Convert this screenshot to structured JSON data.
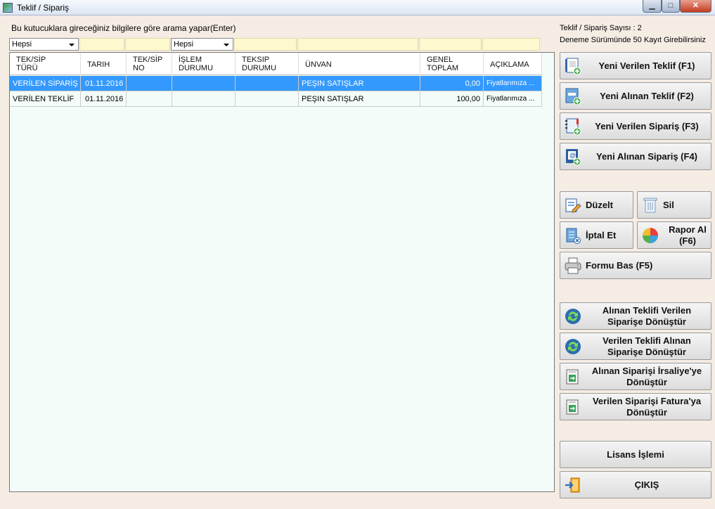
{
  "window": {
    "title": "Teklif / Sipariş",
    "min": "▁",
    "max": "□",
    "close": "✕"
  },
  "hint": "Bu kutucuklara gireceğiniz bilgilere göre arama yapar(Enter)",
  "filters": {
    "type_select": "Hepsi",
    "status_select": "Hepsi"
  },
  "info": {
    "count": "Teklif / Sipariş Sayısı : 2",
    "trial": "Deneme Sürümünde 50 Kayıt Girebilirsiniz"
  },
  "table": {
    "headers": [
      "TEK/SİP\nTÜRÜ",
      "TARIH",
      "TEK/SİP\nNO",
      "İŞLEM\nDURUMU",
      "TEKSIP\nDURUMU",
      "ÜNVAN",
      "GENEL\nTOPLAM",
      "AÇIKLAMA"
    ],
    "rows": [
      [
        "VERİLEN SİPARİŞ",
        "01.11.2016",
        "",
        "",
        "",
        "PEŞIN SATIŞLAR",
        "0,00",
        "Fiyatlarımıza ..."
      ],
      [
        "VERİLEN TEKLİF",
        "01.11.2016",
        "",
        "",
        "",
        "PEŞIN SATIŞLAR",
        "100,00",
        "Fiyatlarımıza ..."
      ]
    ]
  },
  "buttons": {
    "new_given_offer": "Yeni Verilen Teklif (F1)",
    "new_received_offer": "Yeni Alınan Teklif (F2)",
    "new_given_order": "Yeni Verilen Sipariş (F3)",
    "new_received_order": "Yeni Alınan Sipariş (F4)",
    "edit": "Düzelt",
    "delete": "Sil",
    "cancel": "İptal Et",
    "report": "Rapor Al (F6)",
    "print_form": "Formu Bas (F5)",
    "convert1": "Alınan Teklifi Verilen Siparişe Dönüştür",
    "convert2": "Verilen Teklifi Alınan Siparişe Dönüştür",
    "convert3": "Alınan Siparişi İrsaliye'ye Dönüştür",
    "convert4": "Verilen Siparişi Fatura'ya Dönüştür",
    "license": "Lisans İşlemi",
    "exit": "ÇIKIŞ"
  }
}
